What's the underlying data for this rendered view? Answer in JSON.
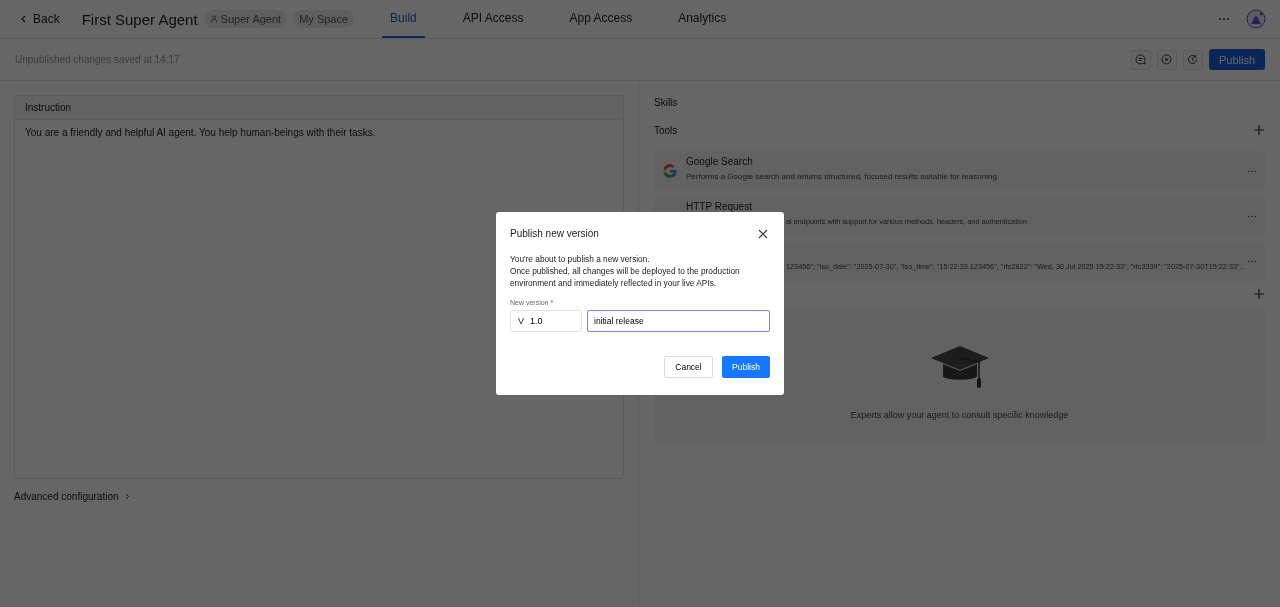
{
  "header": {
    "back": "Back",
    "title": "First Super Agent",
    "badges": [
      {
        "kind": "agent",
        "label": "Super Agent"
      },
      {
        "kind": "plain",
        "label": "My Space"
      }
    ],
    "tabs": [
      {
        "label": "Build",
        "selected": true
      },
      {
        "label": "API Access",
        "selected": false
      },
      {
        "label": "App Access",
        "selected": false
      },
      {
        "label": "Analytics",
        "selected": false
      }
    ]
  },
  "toolbar": {
    "status": "Unpublished changes saved at 14:17",
    "publish": "Publish"
  },
  "instruction": {
    "title": "Instruction",
    "text": "You are a friendly and helpful AI agent. You help human-beings with their tasks."
  },
  "advanced": "Advanced configuration",
  "skills": {
    "title": "Skills"
  },
  "tools": {
    "title": "Tools",
    "items": [
      {
        "name": "Google Search",
        "description": "Performs a Google search and returns structured, focused results suitable for reasoning.",
        "under_dialog": false
      },
      {
        "name": "HTTP Request",
        "description": "al endpoints with support for various methods, headers, and authentication",
        "under_dialog": true
      },
      {
        "description": "123456\", \"iso_date\": \"2025-07-30\", \"iso_time\": \"15:22:33.123456\", \"rfc2822\": \"Wed, 30 Jul 2025 15:22:33\", \"rfc3339\": \"2025-07-30T15:22:33\"...",
        "under_dialog": true
      }
    ]
  },
  "experts": {
    "empty_text": "Experts allow your agent to consult specific knowledge"
  },
  "dialog": {
    "title": "Publish new version",
    "lines": [
      "You're about to publish a new version.",
      "Once published, all changes will be deployed to the production environment and immediately reflected in your live APIs."
    ],
    "field_label": "New version",
    "required_mark": "*",
    "version_prefix": "V",
    "version": "1.0",
    "note": "initial release",
    "cancel": "Cancel",
    "publish": "Publish"
  }
}
